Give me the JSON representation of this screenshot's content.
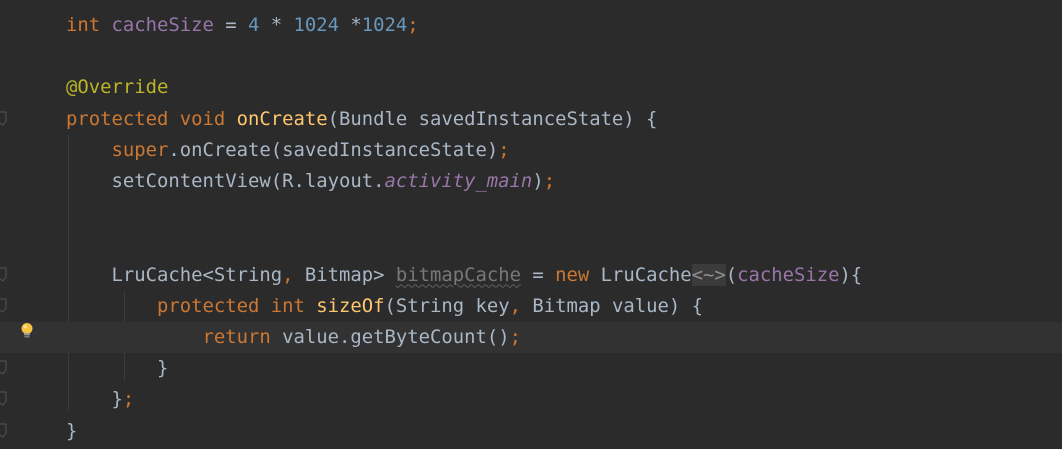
{
  "editor": {
    "lines": [
      {
        "tokens": [
          {
            "t": "int ",
            "c": "kw"
          },
          {
            "t": "cacheSize",
            "c": "field"
          },
          {
            "t": " = ",
            "c": "plain"
          },
          {
            "t": "4",
            "c": "num"
          },
          {
            "t": " * ",
            "c": "plain"
          },
          {
            "t": "1024",
            "c": "num"
          },
          {
            "t": " *",
            "c": "plain"
          },
          {
            "t": "1024",
            "c": "num"
          },
          {
            "t": ";",
            "c": "kw"
          }
        ]
      },
      {
        "tokens": []
      },
      {
        "tokens": [
          {
            "t": "@Override",
            "c": "ann"
          }
        ]
      },
      {
        "tokens": [
          {
            "t": "protected ",
            "c": "kw"
          },
          {
            "t": "void ",
            "c": "kw"
          },
          {
            "t": "onCreate",
            "c": "fn"
          },
          {
            "t": "(Bundle savedInstanceState) {",
            "c": "plain"
          }
        ]
      },
      {
        "tokens": [
          {
            "t": "    ",
            "c": "plain"
          },
          {
            "t": "super",
            "c": "kw"
          },
          {
            "t": ".onCreate(savedInstanceState)",
            "c": "plain"
          },
          {
            "t": ";",
            "c": "kw"
          }
        ]
      },
      {
        "tokens": [
          {
            "t": "    setContentView(R.layout.",
            "c": "plain"
          },
          {
            "t": "activity_main",
            "c": "field-it"
          },
          {
            "t": ")",
            "c": "plain"
          },
          {
            "t": ";",
            "c": "kw"
          }
        ]
      },
      {
        "tokens": []
      },
      {
        "tokens": []
      },
      {
        "tokens": [
          {
            "t": "    LruCache<String",
            "c": "plain"
          },
          {
            "t": ", ",
            "c": "kw"
          },
          {
            "t": "Bitmap> ",
            "c": "plain"
          },
          {
            "t": "bitmapCache",
            "c": "unused"
          },
          {
            "t": " = ",
            "c": "plain"
          },
          {
            "t": "new ",
            "c": "kw"
          },
          {
            "t": "LruCache",
            "c": "plain"
          },
          {
            "t": "<~>",
            "c": "diamond"
          },
          {
            "t": "(",
            "c": "plain"
          },
          {
            "t": "cacheSize",
            "c": "field"
          },
          {
            "t": "){",
            "c": "plain"
          }
        ]
      },
      {
        "tokens": [
          {
            "t": "        ",
            "c": "plain"
          },
          {
            "t": "protected ",
            "c": "kw"
          },
          {
            "t": "int ",
            "c": "kw"
          },
          {
            "t": "sizeOf",
            "c": "fn"
          },
          {
            "t": "(String key",
            "c": "plain"
          },
          {
            "t": ", ",
            "c": "kw"
          },
          {
            "t": "Bitmap value) {",
            "c": "plain"
          }
        ]
      },
      {
        "tokens": [
          {
            "t": "            ",
            "c": "plain"
          },
          {
            "t": "return ",
            "c": "kw"
          },
          {
            "t": "value.getByteCount()",
            "c": "plain"
          },
          {
            "t": ";",
            "c": "kw"
          }
        ]
      },
      {
        "tokens": [
          {
            "t": "        }",
            "c": "plain"
          }
        ]
      },
      {
        "tokens": [
          {
            "t": "    }",
            "c": "plain"
          },
          {
            "t": ";",
            "c": "kw"
          }
        ]
      },
      {
        "tokens": [
          {
            "t": "}",
            "c": "plain"
          }
        ]
      }
    ],
    "current_line": 10,
    "fold_markers": [
      3,
      8,
      9,
      11,
      12,
      13
    ],
    "intention_icon": "lightbulb-icon",
    "colors": {
      "background": "#2b2b2b",
      "current_line": "#323232",
      "keyword": "#cc7832",
      "field": "#9876aa",
      "number": "#6897bb",
      "annotation": "#bbb529",
      "function": "#ffc66d",
      "plain": "#a9b7c6"
    }
  }
}
